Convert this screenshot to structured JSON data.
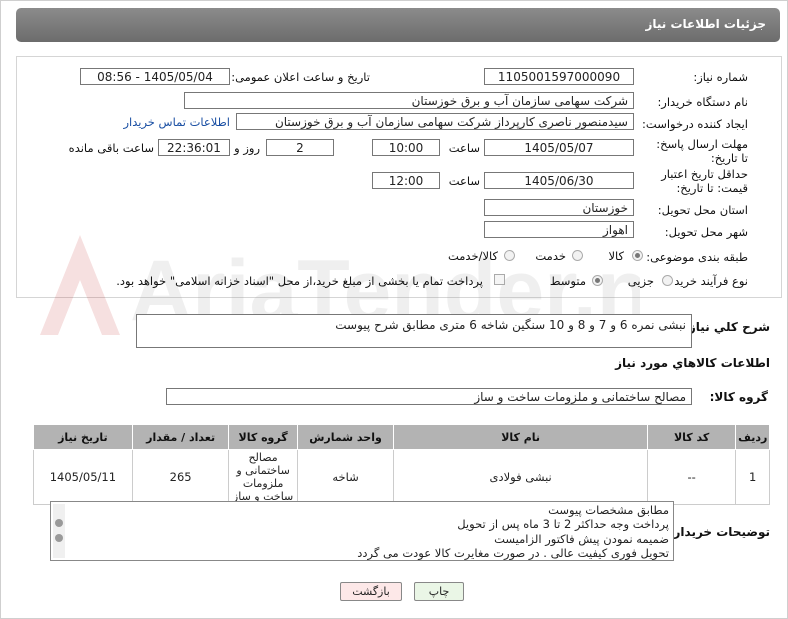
{
  "header": {
    "title": "جزئیات اطلاعات نیاز"
  },
  "fields": {
    "need_number_label": "شماره نیاز:",
    "need_number": "1105001597000090",
    "announce_label": "تاریخ و ساعت اعلان عمومی:",
    "announce_value": "1405/05/04 - 08:56",
    "buyer_label": "نام دستگاه خریدار:",
    "buyer_value": "شرکت سهامی سازمان آب و برق خوزستان",
    "creator_label": "ایجاد کننده درخواست:",
    "creator_value": "سیدمنصور ناصری کارپرداز شرکت سهامی سازمان آب و برق خوزستان",
    "contact_link": "اطلاعات تماس خریدار",
    "deadline_label": "مهلت ارسال پاسخ: تا تاریخ:",
    "deadline_date": "1405/05/07",
    "time_label": "ساعت",
    "deadline_time": "10:00",
    "days_value": "2",
    "days_label": "روز و",
    "remaining_time": "22:36:01",
    "remaining_label": "ساعت باقی مانده",
    "validity_label": "حداقل تاریخ اعتبار قیمت: تا تاریخ:",
    "validity_date": "1405/06/30",
    "validity_time": "12:00",
    "province_label": "استان محل تحویل:",
    "province_value": "خوزستان",
    "city_label": "شهر محل تحویل:",
    "city_value": "اهواز",
    "category_label": "طبقه بندی موضوعی:",
    "category_options": [
      "کالا",
      "خدمت",
      "کالا/خدمت"
    ],
    "process_label": "نوع فرآیند خرید :",
    "process_options": [
      "جزیی",
      "متوسط"
    ],
    "payment_note": "پرداخت تمام یا بخشی از مبلغ خرید،از محل \"اسناد خزانه اسلامی\" خواهد بود."
  },
  "description": {
    "label": "شرح کلي نياز:",
    "value": "نبشی نمره 6 و 7 و 8 و 10 سنگین شاخه 6 متری مطابق شرح پیوست"
  },
  "goods": {
    "section_title": "اطلاعات کالاهاي مورد نياز",
    "group_label": "گروه کالا:",
    "group_value": "مصالح ساختمانی و ملزومات ساخت و ساز",
    "columns": [
      "رديف",
      "کد کالا",
      "نام کالا",
      "واحد شمارش",
      "گروه کالا",
      "تعداد / مقدار",
      "تاريخ نياز"
    ],
    "rows": [
      {
        "index": "1",
        "code": "--",
        "name": "نبشی فولادی",
        "unit": "شاخه",
        "group": "مصالح ساختمانی و ملزومات ساخت و ساز",
        "qty": "265",
        "date": "1405/05/11"
      }
    ]
  },
  "buyer_notes": {
    "label": "توضیحات خریدار:",
    "lines": [
      "مطابق مشخصات پیوست",
      "پرداخت وجه حداکثر 2 تا 3 ماه پس از تحویل",
      "ضمیمه نمودن پیش فاکتور الزامیست",
      "تحویل فوری کیفیت عالی . در صورت مغایرت کالا عودت می گردد"
    ]
  },
  "buttons": {
    "print": "چاپ",
    "back": "بازگشت"
  },
  "watermark": {
    "text": "AriaTender.neT"
  },
  "colors": {
    "header": "#7a7a7a",
    "link": "#1a4fa3",
    "table_head": "#b3b3b3",
    "back_button": "#fde8e8",
    "print_button": "#eaf6e6"
  }
}
